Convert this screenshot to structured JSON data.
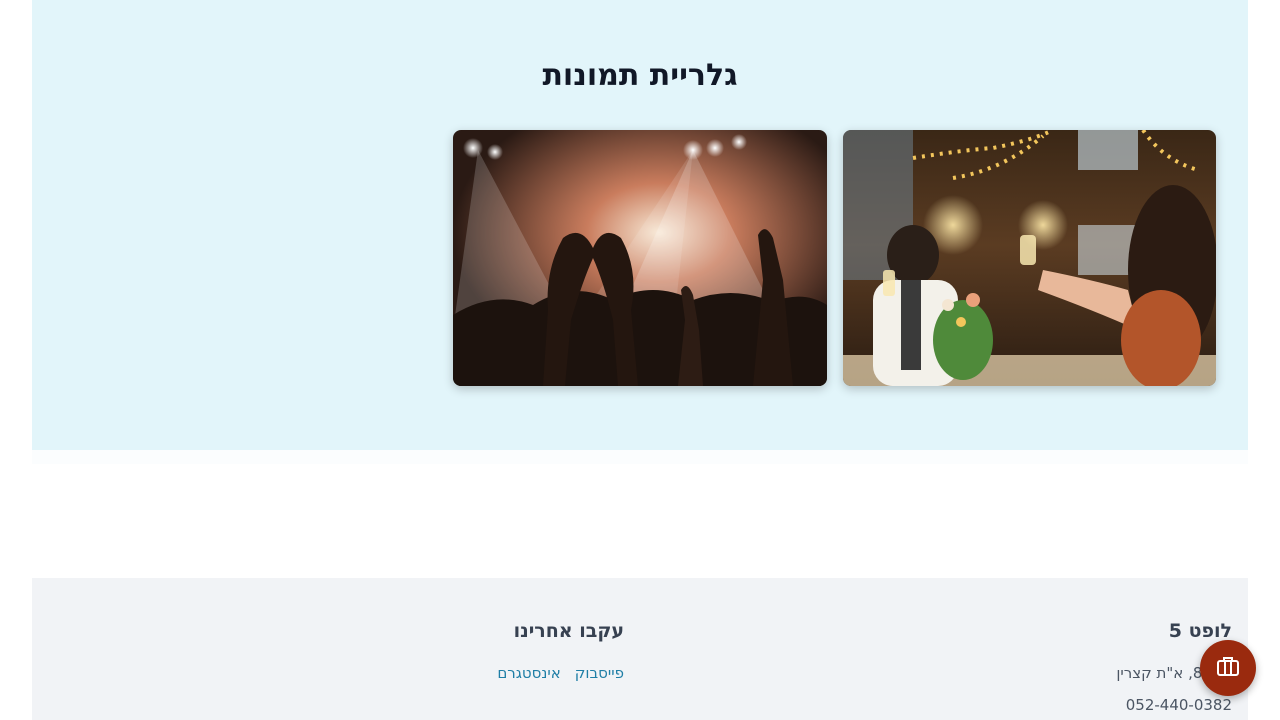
{
  "gallery": {
    "title": "גלריית תמונות",
    "photos": [
      {
        "name": "party-photo",
        "subject": "toast at a dinner party under string lights"
      },
      {
        "name": "concert-photo",
        "subject": "concert crowd making a heart with hands"
      }
    ]
  },
  "footer": {
    "venue_name": "לופט 5",
    "address": "…ה 8, א\"ת קצרין",
    "phone": "052-440-0382",
    "follow_heading": "עקבו אחרינו",
    "social": {
      "facebook": "פייסבוק",
      "instagram": "אינסטגרם"
    }
  },
  "fab": {
    "icon": "briefcase-icon"
  },
  "colors": {
    "gallery_bg": "#e2f5fa",
    "footer_bg": "#f1f3f6",
    "link": "#1f7ea6",
    "fab": "#9a2a0e"
  }
}
